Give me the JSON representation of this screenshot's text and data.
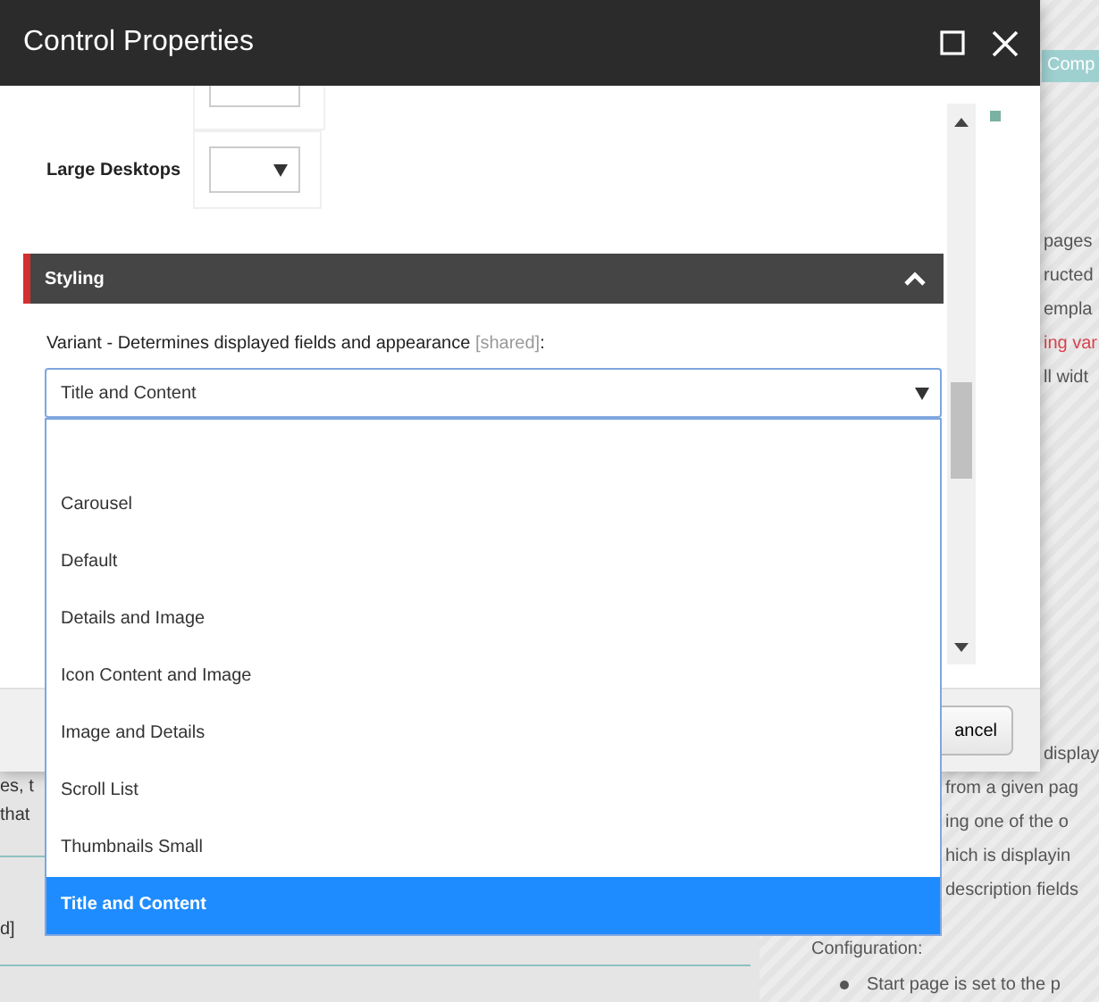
{
  "background_page": {
    "tab": "Comp",
    "upper_right_lines": [
      {
        "text": "pages",
        "kind": "text"
      },
      {
        "text": "ructed",
        "kind": "text"
      },
      {
        "text": "empla",
        "kind": "text"
      },
      {
        "text": "ing var",
        "kind": "link"
      },
      {
        "text": "ll widt",
        "kind": "text"
      }
    ],
    "lower_right_lines": [
      {
        "text": "display"
      },
      {
        "text": "from a given pag"
      },
      {
        "text": "ing one of the o"
      },
      {
        "text": "hich is displayin"
      },
      {
        "text": "description fields"
      }
    ],
    "heading": "Configuration:",
    "bullet": "Start page is set to the p",
    "left_lines": [
      {
        "text": "es, t"
      },
      {
        "text": "that"
      }
    ],
    "left_tail": "d]",
    "cancel_button": "ancel"
  },
  "dialog": {
    "title": "Control Properties",
    "device_rows": [
      {
        "label": "Large Desktops"
      }
    ],
    "section": {
      "title": "Styling",
      "expanded": true
    },
    "variant_label": "Variant - Determines displayed fields and appearance",
    "shared_tag": "[shared]",
    "label_suffix": ":",
    "select_value": "Title and Content",
    "options": [
      {
        "label": "Carousel",
        "selected": false
      },
      {
        "label": "Default",
        "selected": false
      },
      {
        "label": "Details and Image",
        "selected": false
      },
      {
        "label": "Icon Content and Image",
        "selected": false
      },
      {
        "label": "Image and Details",
        "selected": false
      },
      {
        "label": "Scroll List",
        "selected": false
      },
      {
        "label": "Thumbnails Small",
        "selected": false
      },
      {
        "label": "Title and Content",
        "selected": true
      }
    ]
  }
}
